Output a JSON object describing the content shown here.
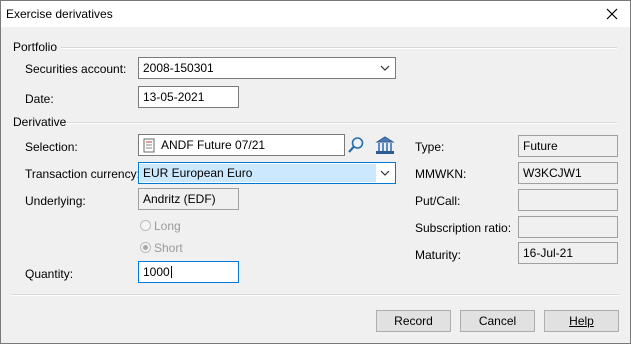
{
  "window": {
    "title": "Exercise derivatives"
  },
  "portfolio": {
    "section_label": "Portfolio",
    "securities_account_label": "Securities account:",
    "securities_account_value": "2008-150301",
    "date_label": "Date:",
    "date_value": "13-05-2021"
  },
  "derivative": {
    "section_label": "Derivative",
    "selection_label": "Selection:",
    "selection_value": "ANDF Future 07/21",
    "transaction_currency_label": "Transaction currency:",
    "transaction_currency_value": "EUR European Euro",
    "underlying_label": "Underlying:",
    "underlying_value": "Andritz (EDF)",
    "long_label": "Long",
    "short_label": "Short",
    "quantity_label": "Quantity:",
    "quantity_value": "1000",
    "type_label": "Type:",
    "type_value": "Future",
    "mmwkn_label": "MMWKN:",
    "mmwkn_value": "W3KCJW1",
    "put_call_label": "Put/Call:",
    "put_call_value": "",
    "subscription_ratio_label": "Subscription ratio:",
    "subscription_ratio_value": "",
    "maturity_label": "Maturity:",
    "maturity_value": "16-Jul-21"
  },
  "buttons": {
    "record": "Record",
    "cancel": "Cancel",
    "help": "Help"
  },
  "colors": {
    "accent": "#0078d7",
    "selection_highlight": "#cce8ff"
  },
  "icons": {
    "close": "close-icon",
    "dropdown": "chevron-down-icon",
    "selection_item": "document-icon",
    "search": "magnifier-icon",
    "bank": "bank-icon"
  }
}
